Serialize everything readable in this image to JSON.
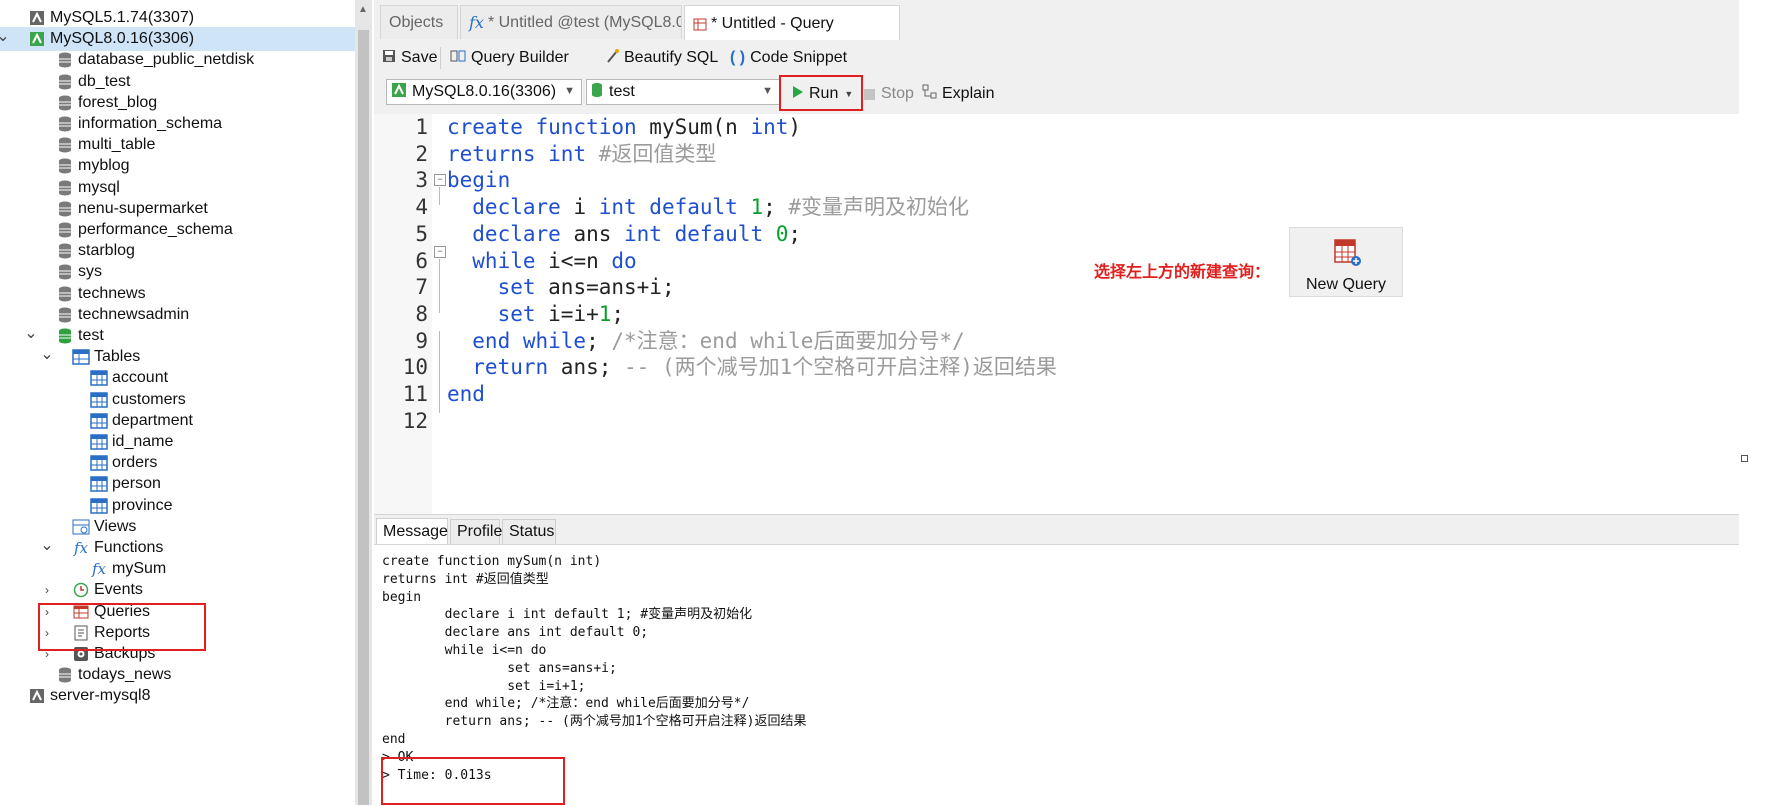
{
  "sidebar": {
    "items": [
      {
        "label": "MySQL5.1.74(3307)",
        "level": 0,
        "icon": "server-icon",
        "chevron": "none"
      },
      {
        "label": "MySQL8.0.16(3306)",
        "level": 0,
        "icon": "server-connected-icon",
        "chevron": "expanded",
        "selected": true
      },
      {
        "label": "database_public_netdisk",
        "level": 1,
        "icon": "database-icon",
        "chevron": "none"
      },
      {
        "label": "db_test",
        "level": 1,
        "icon": "database-icon",
        "chevron": "none"
      },
      {
        "label": "forest_blog",
        "level": 1,
        "icon": "database-icon",
        "chevron": "none"
      },
      {
        "label": "information_schema",
        "level": 1,
        "icon": "database-icon",
        "chevron": "none"
      },
      {
        "label": "multi_table",
        "level": 1,
        "icon": "database-icon",
        "chevron": "none"
      },
      {
        "label": "myblog",
        "level": 1,
        "icon": "database-icon",
        "chevron": "none"
      },
      {
        "label": "mysql",
        "level": 1,
        "icon": "database-icon",
        "chevron": "none"
      },
      {
        "label": "nenu-supermarket",
        "level": 1,
        "icon": "database-icon",
        "chevron": "none"
      },
      {
        "label": "performance_schema",
        "level": 1,
        "icon": "database-icon",
        "chevron": "none"
      },
      {
        "label": "starblog",
        "level": 1,
        "icon": "database-icon",
        "chevron": "none"
      },
      {
        "label": "sys",
        "level": 1,
        "icon": "database-icon",
        "chevron": "none"
      },
      {
        "label": "technews",
        "level": 1,
        "icon": "database-icon",
        "chevron": "none"
      },
      {
        "label": "technewsadmin",
        "level": 1,
        "icon": "database-icon",
        "chevron": "none"
      },
      {
        "label": "test",
        "level": 1,
        "icon": "database-open-icon",
        "chevron": "expanded"
      },
      {
        "label": "Tables",
        "level": 2,
        "icon": "tables-icon",
        "chevron": "expanded"
      },
      {
        "label": "account",
        "level": 3,
        "icon": "table-icon",
        "chevron": "none"
      },
      {
        "label": "customers",
        "level": 3,
        "icon": "table-icon",
        "chevron": "none"
      },
      {
        "label": "department",
        "level": 3,
        "icon": "table-icon",
        "chevron": "none"
      },
      {
        "label": "id_name",
        "level": 3,
        "icon": "table-icon",
        "chevron": "none"
      },
      {
        "label": "orders",
        "level": 3,
        "icon": "table-icon",
        "chevron": "none"
      },
      {
        "label": "person",
        "level": 3,
        "icon": "table-icon",
        "chevron": "none"
      },
      {
        "label": "province",
        "level": 3,
        "icon": "table-icon",
        "chevron": "none"
      },
      {
        "label": "Views",
        "level": 2,
        "icon": "views-icon",
        "chevron": "none"
      },
      {
        "label": "Functions",
        "level": 2,
        "icon": "function-icon",
        "chevron": "expanded"
      },
      {
        "label": "mySum",
        "level": 3,
        "icon": "function-icon",
        "chevron": "none"
      },
      {
        "label": "Events",
        "level": 2,
        "icon": "events-icon",
        "chevron": "collapsed"
      },
      {
        "label": "Queries",
        "level": 2,
        "icon": "queries-icon",
        "chevron": "collapsed"
      },
      {
        "label": "Reports",
        "level": 2,
        "icon": "reports-icon",
        "chevron": "collapsed"
      },
      {
        "label": "Backups",
        "level": 2,
        "icon": "backups-icon",
        "chevron": "collapsed"
      },
      {
        "label": "todays_news",
        "level": 1,
        "icon": "database-icon",
        "chevron": "none"
      },
      {
        "label": "server-mysql8",
        "level": 0,
        "icon": "server-icon",
        "chevron": "none"
      }
    ]
  },
  "tabs": [
    {
      "label": "Objects",
      "active": false
    },
    {
      "label": "* Untitled @test (MySQL8.0....",
      "active": false,
      "icon": "function-icon"
    },
    {
      "label": "* Untitled - Query",
      "active": true,
      "icon": "query-icon"
    }
  ],
  "toolbar": {
    "save": "Save",
    "query_builder": "Query Builder",
    "beautify": "Beautify SQL",
    "snippet": "Code Snippet",
    "connection": "MySQL8.0.16(3306)",
    "database": "test",
    "run": "Run",
    "stop": "Stop",
    "explain": "Explain"
  },
  "editor": {
    "line_numbers": [
      "1",
      "2",
      "3",
      "4",
      "5",
      "6",
      "7",
      "8",
      "9",
      "10",
      "11",
      "12"
    ],
    "lines": [
      [
        {
          "t": "create function ",
          "c": "k"
        },
        {
          "t": "mySum(n ",
          "c": "t"
        },
        {
          "t": "int",
          "c": "k"
        },
        {
          "t": ")",
          "c": "t"
        }
      ],
      [
        {
          "t": "returns ",
          "c": "k"
        },
        {
          "t": "int ",
          "c": "k"
        },
        {
          "t": "#返回值类型",
          "c": "c"
        }
      ],
      [
        {
          "t": "begin",
          "c": "k"
        }
      ],
      [
        {
          "t": "  declare ",
          "c": "k"
        },
        {
          "t": "i ",
          "c": "t"
        },
        {
          "t": "int default ",
          "c": "k"
        },
        {
          "t": "1",
          "c": "n"
        },
        {
          "t": "; ",
          "c": "t"
        },
        {
          "t": "#变量声明及初始化",
          "c": "c"
        }
      ],
      [
        {
          "t": "  declare ",
          "c": "k"
        },
        {
          "t": "ans ",
          "c": "t"
        },
        {
          "t": "int default ",
          "c": "k"
        },
        {
          "t": "0",
          "c": "n"
        },
        {
          "t": ";",
          "c": "t"
        }
      ],
      [
        {
          "t": "  while ",
          "c": "k"
        },
        {
          "t": "i<=n ",
          "c": "t"
        },
        {
          "t": "do",
          "c": "k"
        }
      ],
      [
        {
          "t": "    set ",
          "c": "k"
        },
        {
          "t": "ans=ans+i;",
          "c": "t"
        }
      ],
      [
        {
          "t": "    set ",
          "c": "k"
        },
        {
          "t": "i=i+",
          "c": "t"
        },
        {
          "t": "1",
          "c": "n"
        },
        {
          "t": ";",
          "c": "t"
        }
      ],
      [
        {
          "t": "  end while",
          "c": "k"
        },
        {
          "t": "; ",
          "c": "t"
        },
        {
          "t": "/*注意：end while后面要加分号*/",
          "c": "c"
        }
      ],
      [
        {
          "t": "  return ",
          "c": "k"
        },
        {
          "t": "ans; ",
          "c": "t"
        },
        {
          "t": "-- (两个减号加1个空格可开启注释)返回结果",
          "c": "c"
        }
      ],
      [
        {
          "t": "end",
          "c": "k"
        }
      ],
      []
    ]
  },
  "annotation": {
    "text": "选择左上方的新建查询：",
    "new_query_label": "New Query"
  },
  "bottom_tabs": [
    "Message",
    "Profile",
    "Status"
  ],
  "messages": [
    "create function mySum(n int)",
    "returns int #返回值类型",
    "begin",
    "        declare i int default 1; #变量声明及初始化",
    "        declare ans int default 0;",
    "        while i<=n do",
    "                set ans=ans+i;",
    "                set i=i+1;",
    "        end while; /*注意：end while后面要加分号*/",
    "        return ans; -- (两个减号加1个空格可开启注释)返回结果",
    "end",
    "> OK",
    "> Time: 0.013s"
  ],
  "colors": {
    "keyword": "#1f4fd1",
    "number": "#0a9e2c",
    "comment": "#9b9b9b",
    "highlight": "#e0201e",
    "selection": "#cfe4f7"
  }
}
